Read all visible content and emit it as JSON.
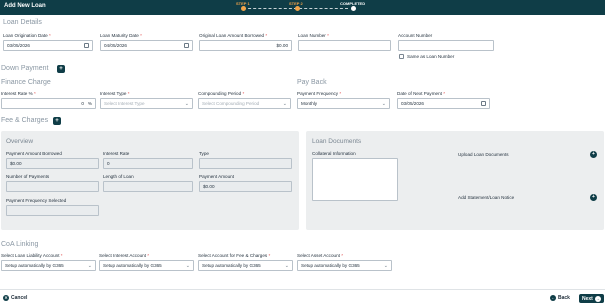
{
  "header": {
    "title": "Add New Loan",
    "steps": [
      {
        "label": "STEP 1"
      },
      {
        "label": "STEP 2"
      },
      {
        "label": "COMPLETED"
      }
    ]
  },
  "loan_details": {
    "section": "Loan Details",
    "origination_date": {
      "label": "Loan Origination Date",
      "value": "03/05/2026"
    },
    "maturity_date": {
      "label": "Loan Maturity Date",
      "value": "04/05/2026"
    },
    "original_amount": {
      "label": "Original Loan Amount Borrowed",
      "value": "$0.00"
    },
    "loan_number": {
      "label": "Loan Number",
      "value": ""
    },
    "account_number": {
      "label": "Account Number",
      "value": ""
    },
    "same_as_loan_number": "Same as Loan Number"
  },
  "down_payment": {
    "section": "Down Payment"
  },
  "finance_charge": {
    "section": "Finance Charge",
    "interest_rate": {
      "label": "Interest Rate %",
      "value": "0",
      "suffix": "%"
    },
    "interest_type": {
      "label": "Interest Type",
      "placeholder": "Select Interest Type"
    },
    "compounding_period": {
      "label": "Compounding Period",
      "placeholder": "Select Compounding Period"
    }
  },
  "pay_back": {
    "section": "Pay Back",
    "payment_frequency": {
      "label": "Payment Frequency",
      "value": "Monthly"
    },
    "next_payment_date": {
      "label": "Date of Next Payment",
      "value": "03/05/2026"
    }
  },
  "fee_charges": {
    "section": "Fee & Charges"
  },
  "overview": {
    "title": "Overview",
    "payment_amount_borrowed": {
      "label": "Payment Amount Borrowed",
      "value": "$0.00"
    },
    "interest_rate": {
      "label": "Interest Rate",
      "value": "0"
    },
    "type": {
      "label": "Type",
      "value": ""
    },
    "number_of_payments": {
      "label": "Number of Payments",
      "value": ""
    },
    "length_of_loan": {
      "label": "Length of Loan",
      "value": ""
    },
    "payment_amount": {
      "label": "Payment Amount",
      "value": "$0.00"
    },
    "payment_frequency_selected": {
      "label": "Payment Frequency Selected",
      "value": ""
    }
  },
  "loan_documents": {
    "title": "Loan Documents",
    "collateral_label": "Collateral Information",
    "upload_label": "Upload Loan Documents",
    "add_statement_label": "Add Statement/Loan Notice"
  },
  "coa_linking": {
    "section": "CoA Linking",
    "liability": {
      "label": "Select Loan Liability Account",
      "value": "Setup automatically by G365"
    },
    "interest": {
      "label": "Select Interest Account",
      "value": "Setup automatically by G365"
    },
    "fee": {
      "label": "Select Account for Fee & Charges",
      "value": "Setup automatically by G365"
    },
    "asset": {
      "label": "Select Asset Account",
      "value": "Setup automatically by G365"
    }
  },
  "footer": {
    "cancel": "Cancel",
    "back": "Back",
    "next": "Next"
  },
  "colors": {
    "primary": "#0f3d47",
    "accent": "#f0a44a",
    "required": "#e04b4b"
  }
}
